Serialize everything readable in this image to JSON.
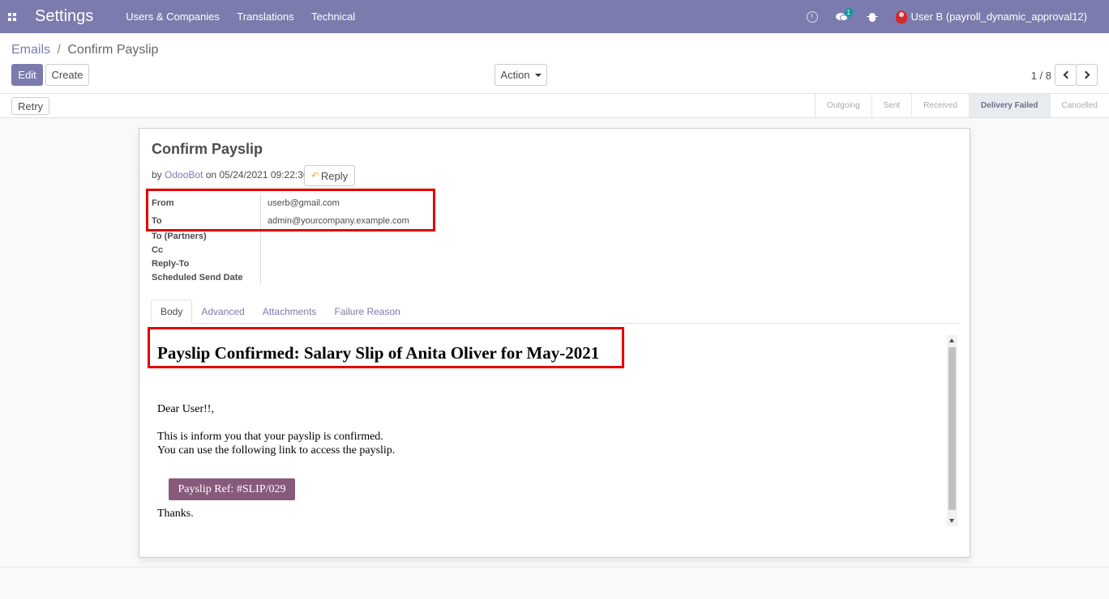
{
  "navbar": {
    "brand": "Settings",
    "menu": [
      "Users & Companies",
      "Translations",
      "Technical"
    ],
    "chat_count": "1",
    "user": "User B (payroll_dynamic_approval12)"
  },
  "breadcrumb": {
    "parent": "Emails",
    "separator": "/",
    "current": "Confirm Payslip"
  },
  "buttons": {
    "edit": "Edit",
    "create": "Create",
    "action": "Action",
    "retry": "Retry"
  },
  "pager": {
    "value": "1 / 8"
  },
  "stages": [
    "Outgoing",
    "Sent",
    "Received",
    "Delivery Failed",
    "Cancelled"
  ],
  "active_stage": "Delivery Failed",
  "record": {
    "title": "Confirm Payslip",
    "by_prefix": "by",
    "author": "OdooBot",
    "on_prefix": "on",
    "date": "05/24/2021 09:22:36",
    "reply_label": "Reply"
  },
  "fields": [
    {
      "label": "From",
      "value": "userb@gmail.com"
    },
    {
      "label": "To",
      "value": "admin@yourcompany.example.com"
    },
    {
      "label": "To (Partners)",
      "value": ""
    },
    {
      "label": "Cc",
      "value": ""
    },
    {
      "label": "Reply-To",
      "value": ""
    },
    {
      "label": "Scheduled Send Date",
      "value": ""
    }
  ],
  "tabs": [
    "Body",
    "Advanced",
    "Attachments",
    "Failure Reason"
  ],
  "mail": {
    "heading": "Payslip Confirmed: Salary Slip of Anita Oliver for May-2021",
    "greeting": "Dear User!!,",
    "line1": "This is inform you that your payslip is confirmed.",
    "line2": "You can use the following link to access the payslip.",
    "button": "Payslip Ref: #SLIP/029",
    "closing": "Thanks."
  },
  "colors": {
    "navbar": "#7c7bad",
    "primary": "#7c7bad",
    "mail_button": "#875a7b",
    "highlight": "#e30000"
  }
}
